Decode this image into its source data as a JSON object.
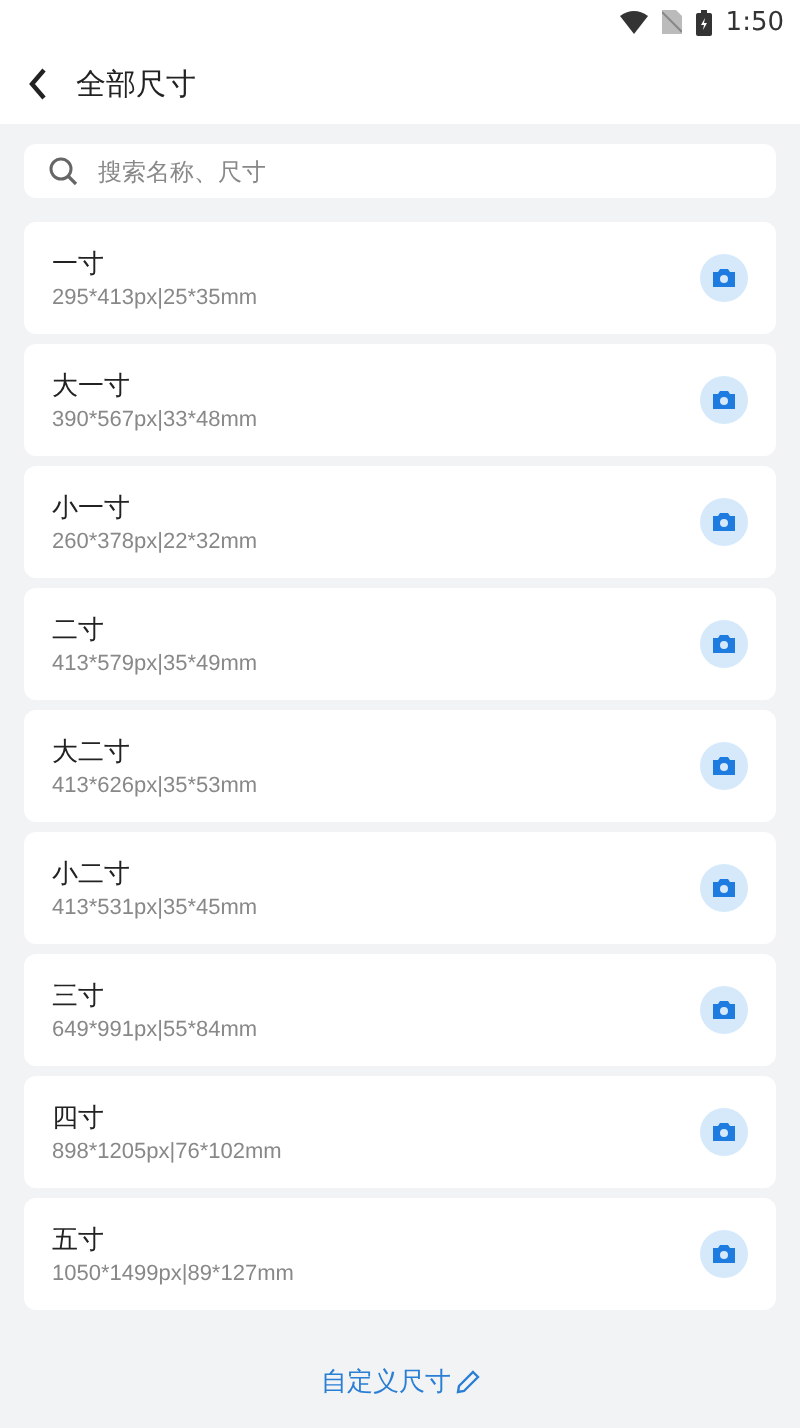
{
  "status_bar": {
    "time": "1:50"
  },
  "header": {
    "title": "全部尺寸"
  },
  "search": {
    "placeholder": "搜索名称、尺寸"
  },
  "sizes": [
    {
      "name": "一寸",
      "detail": "295*413px|25*35mm"
    },
    {
      "name": "大一寸",
      "detail": "390*567px|33*48mm"
    },
    {
      "name": "小一寸",
      "detail": "260*378px|22*32mm"
    },
    {
      "name": "二寸",
      "detail": "413*579px|35*49mm"
    },
    {
      "name": "大二寸",
      "detail": "413*626px|35*53mm"
    },
    {
      "name": "小二寸",
      "detail": "413*531px|35*45mm"
    },
    {
      "name": "三寸",
      "detail": "649*991px|55*84mm"
    },
    {
      "name": "四寸",
      "detail": "898*1205px|76*102mm"
    },
    {
      "name": "五寸",
      "detail": "1050*1499px|89*127mm"
    }
  ],
  "footer": {
    "link": "自定义尺寸"
  }
}
